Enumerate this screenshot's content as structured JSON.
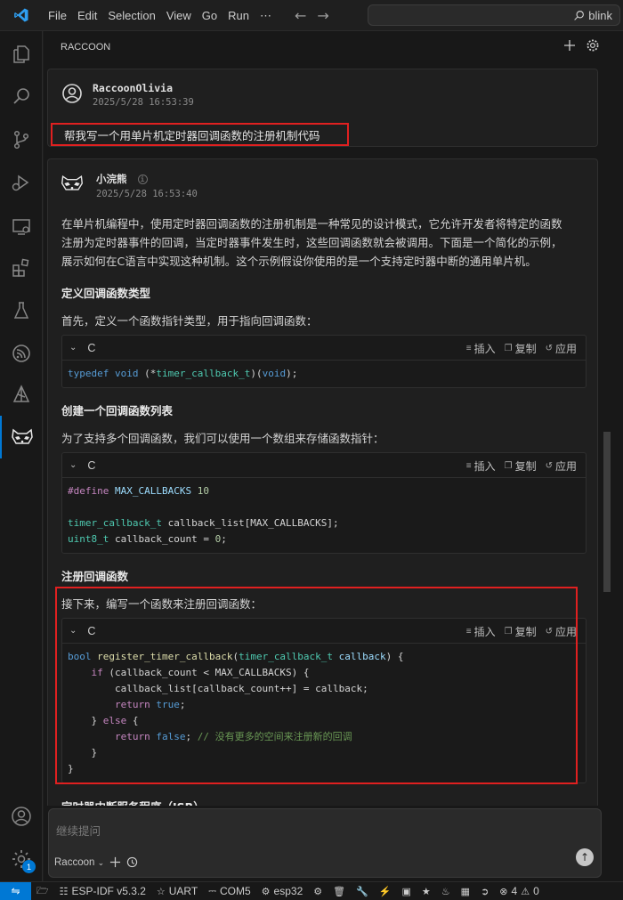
{
  "titlebar": {
    "menu": [
      "File",
      "Edit",
      "Selection",
      "View",
      "Go",
      "Run",
      "⋯"
    ],
    "search_text": "blink"
  },
  "panel": {
    "title": "RACCOON"
  },
  "user_message": {
    "name": "RaccoonOlivia",
    "time": "2025/5/28 16:53:39",
    "text": "帮我写一个用单片机定时器回调函数的注册机制代码"
  },
  "bot_message": {
    "name": "小浣熊",
    "time": "2025/5/28 16:53:40",
    "intro_lines": [
      "在单片机编程中，使用定时器回调函数的注册机制是一种常见的设计模式，它允许开发者将特定的函数",
      "注册为定时器事件的回调，当定时器事件发生时，这些回调函数就会被调用。下面是一个简化的示例，",
      "展示如何在C语言中实现这种机制。这个示例假设你使用的是一个支持定时器中断的通用单片机。"
    ],
    "section1_title": "定义回调函数类型",
    "section1_text": "首先，定义一个函数指针类型，用于指向回调函数：",
    "section2_title": "创建一个回调函数列表",
    "section2_text": "为了支持多个回调函数，我们可以使用一个数组来存储函数指针：",
    "section3_title": "注册回调函数",
    "section3_text": "接下来，编写一个函数来注册回调函数：",
    "section4_title": "定时器中断服务程序（ISR）"
  },
  "codeblock": {
    "lang": "C",
    "insert_label": "插入",
    "copy_label": "复制",
    "apply_label": "应用"
  },
  "code": {
    "c1_typedef": "typedef",
    "c1_void": "void",
    "c1_open": " (*",
    "c1_name": "timer_callback_t",
    "c1_close": ")(",
    "c1_void2": "void",
    "c1_end": ");",
    "c2_define": "#define",
    "c2_macro": "MAX_CALLBACKS",
    "c2_num": "10",
    "c2_type1": "timer_callback_t",
    "c2_decl1": " callback_list[MAX_CALLBACKS];",
    "c2_type2": "uint8_t",
    "c2_decl2": " callback_count = ",
    "c2_zero": "0",
    "c2_semi": ";",
    "c3_bool": "bool",
    "c3_fn": "register_timer_callback",
    "c3_type": "timer_callback_t",
    "c3_param": "callback",
    "c3_if": "if",
    "c3_cond": " (callback_count < MAX_CALLBACKS) {",
    "c3_assign": "callback_list[callback_count++] = callback;",
    "c3_return": "return",
    "c3_true": "true",
    "c3_else": "else",
    "c3_false": "false",
    "c3_comment": "// 没有更多的空间来注册新的回调"
  },
  "input": {
    "placeholder": "继续提问",
    "agent": "Raccoon"
  },
  "activity": {
    "badge": "1"
  },
  "statusbar": {
    "espidf": "ESP-IDF v5.3.2",
    "uart": "UART",
    "com": "COM5",
    "chip": "esp32",
    "errors": "4",
    "warnings": "0"
  }
}
